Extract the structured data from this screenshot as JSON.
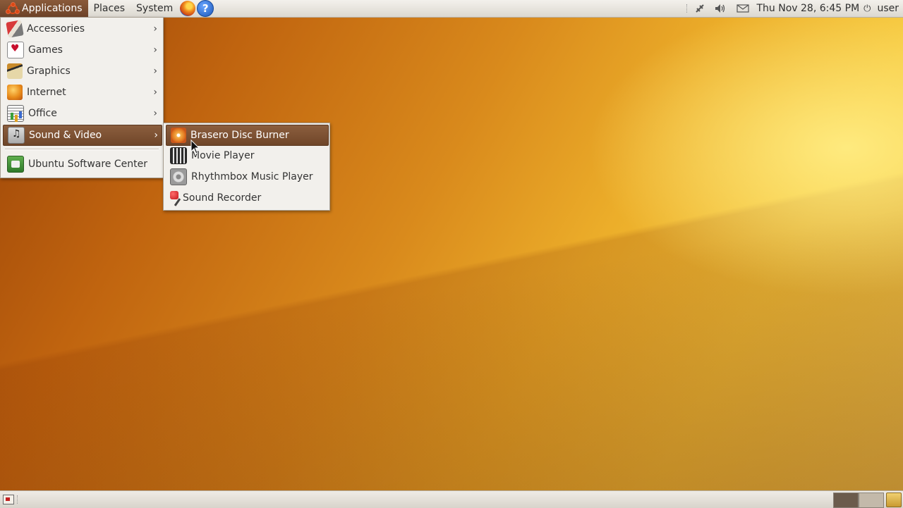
{
  "top_panel": {
    "menus": {
      "applications": "Applications",
      "places": "Places",
      "system": "System"
    },
    "launchers": [
      {
        "name": "firefox",
        "icon": "firefox-icon"
      },
      {
        "name": "help",
        "icon": "help-icon",
        "glyph": "?"
      }
    ],
    "tray": {
      "network_icon": "network-icon",
      "volume_icon": "volume-icon",
      "mail_icon": "mail-icon",
      "clock": "Thu Nov 28,  6:45 PM",
      "power_icon": "power-icon",
      "user": "user"
    }
  },
  "applications_menu": {
    "items": [
      {
        "label": "Accessories",
        "icon": "accessories-icon",
        "has_submenu": true
      },
      {
        "label": "Games",
        "icon": "games-icon",
        "has_submenu": true
      },
      {
        "label": "Graphics",
        "icon": "graphics-icon",
        "has_submenu": true
      },
      {
        "label": "Internet",
        "icon": "internet-icon",
        "has_submenu": true
      },
      {
        "label": "Office",
        "icon": "office-icon",
        "has_submenu": true
      },
      {
        "label": "Sound & Video",
        "icon": "sound-video-icon",
        "has_submenu": true,
        "highlighted": true
      },
      {
        "label": "Ubuntu Software Center",
        "icon": "software-center-icon",
        "has_submenu": false
      }
    ]
  },
  "sound_video_menu": {
    "items": [
      {
        "label": "Brasero Disc Burner",
        "icon": "brasero-icon",
        "highlighted": true
      },
      {
        "label": "Movie Player",
        "icon": "movie-player-icon"
      },
      {
        "label": "Rhythmbox Music Player",
        "icon": "rhythmbox-icon"
      },
      {
        "label": "Sound Recorder",
        "icon": "sound-recorder-icon"
      }
    ]
  },
  "bottom_panel": {
    "show_desktop_icon": "show-desktop-icon",
    "workspaces": [
      "workspace-1",
      "workspace-2"
    ],
    "trash_icon": "trash-icon"
  },
  "colors": {
    "highlight": "#7a4e31",
    "menu_bg": "#f2f0ec",
    "panel_bg": "#dcd8d0",
    "ubuntu_orange": "#dd4814"
  }
}
